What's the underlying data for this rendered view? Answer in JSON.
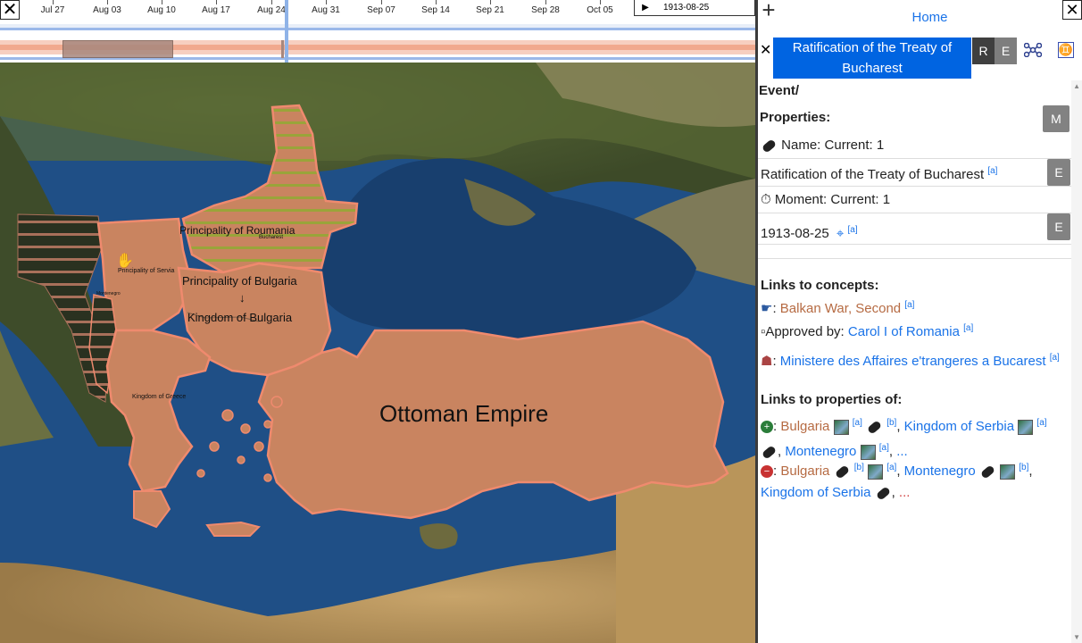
{
  "timeline": {
    "ticks": [
      "Jul 27",
      "Aug 03",
      "Aug 10",
      "Aug 17",
      "Aug 24",
      "Aug 31",
      "Sep 07",
      "Sep 14",
      "Sep 21",
      "Sep 28",
      "Oct 05"
    ],
    "current_date": "1913-08-25",
    "close_label": "✕",
    "play_label": "▶"
  },
  "map": {
    "labels": {
      "roumania": "Principality of Roumania",
      "bucharest": "Bucharest",
      "servia": "Principality of Servia",
      "montenegro": "Montenegro",
      "bulgaria_principality": "Principality of Bulgaria",
      "arrow": "↓",
      "bulgaria_kingdom": "Kingdom of Bulgaria",
      "greece": "Kingdom of Greece",
      "ottoman": "Ottoman Empire"
    }
  },
  "panel": {
    "add_label": "+",
    "home_label": "Home",
    "close_label": "✕",
    "tab": {
      "close_label": "✕",
      "title": "Ratification of the Treaty of Bucharest",
      "r_label": "R",
      "e_label": "E"
    },
    "path": "Event/",
    "properties_label": "Properties:",
    "m_label": "M",
    "name_heading": "Name: Current: 1",
    "name_value": "Ratification of the Treaty of Bucharest",
    "ref_a": "[a]",
    "ref_b": "[b]",
    "edit_label": "E",
    "moment_heading": "Moment: Current: 1",
    "moment_value": "1913-08-25",
    "links_concepts_label": "Links to concepts:",
    "concepts": {
      "war": "Balkan War, Second",
      "approved_prefix": "Approved by:",
      "approved": "Carol I of Romania",
      "ministry": "Ministere des Affaires e'trangeres a Bucarest"
    },
    "links_props_label": "Links to properties of:",
    "props_plus": {
      "a": "Bulgaria",
      "b": "Kingdom of Serbia",
      "c": "Montenegro",
      "more": "..."
    },
    "props_minus": {
      "a": "Bulgaria",
      "b": "Montenegro",
      "c": "Kingdom of Serbia",
      "more": "..."
    }
  }
}
